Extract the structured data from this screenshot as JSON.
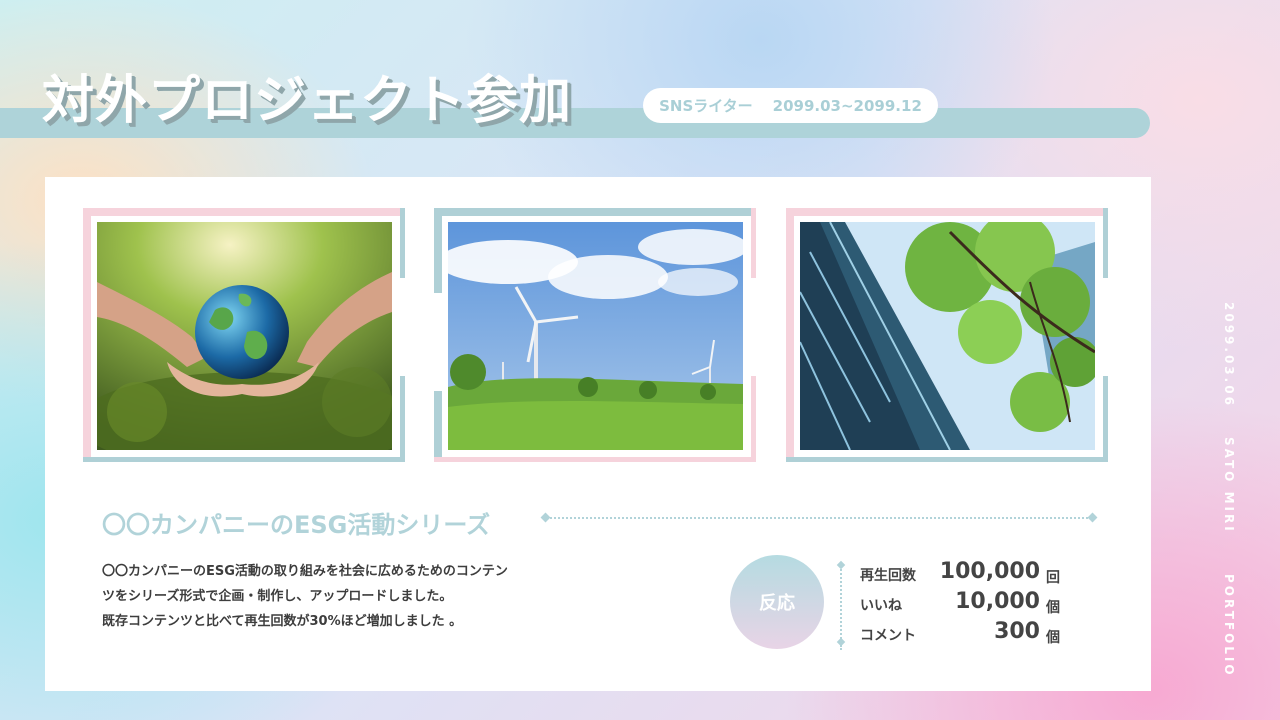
{
  "header": {
    "title": "対外プロジェクト参加",
    "role": "SNSライター",
    "period": "2099.03~2099.12"
  },
  "photos": [
    {
      "icon": "earth-in-hands-photo"
    },
    {
      "icon": "wind-turbines-photo"
    },
    {
      "icon": "glass-building-trees-photo"
    }
  ],
  "section": {
    "title": "〇〇カンパニーのESG活動シリーズ",
    "description": [
      "〇〇カンパニーのESG活動の取り組みを社会に広めるためのコンテン",
      "ツをシリーズ形式で企画・制作し、アップロードしました。",
      "既存コンテンツと比べて再生回数が30%ほど増加しました 。"
    ]
  },
  "reaction": {
    "label": "反応",
    "stats": [
      {
        "label": "再生回数",
        "value": "100,000",
        "unit": "回"
      },
      {
        "label": "いいね",
        "value": "10,000",
        "unit": "個"
      },
      {
        "label": "コメント",
        "value": "300",
        "unit": "個"
      }
    ]
  },
  "side": {
    "date": "2099.03.06",
    "name": "SATO MIRI",
    "label": "PORTFOLIO"
  },
  "colors": {
    "accent_teal": "#aed3d9",
    "accent_pink": "#f6d3dc",
    "card": "#ffffff"
  }
}
